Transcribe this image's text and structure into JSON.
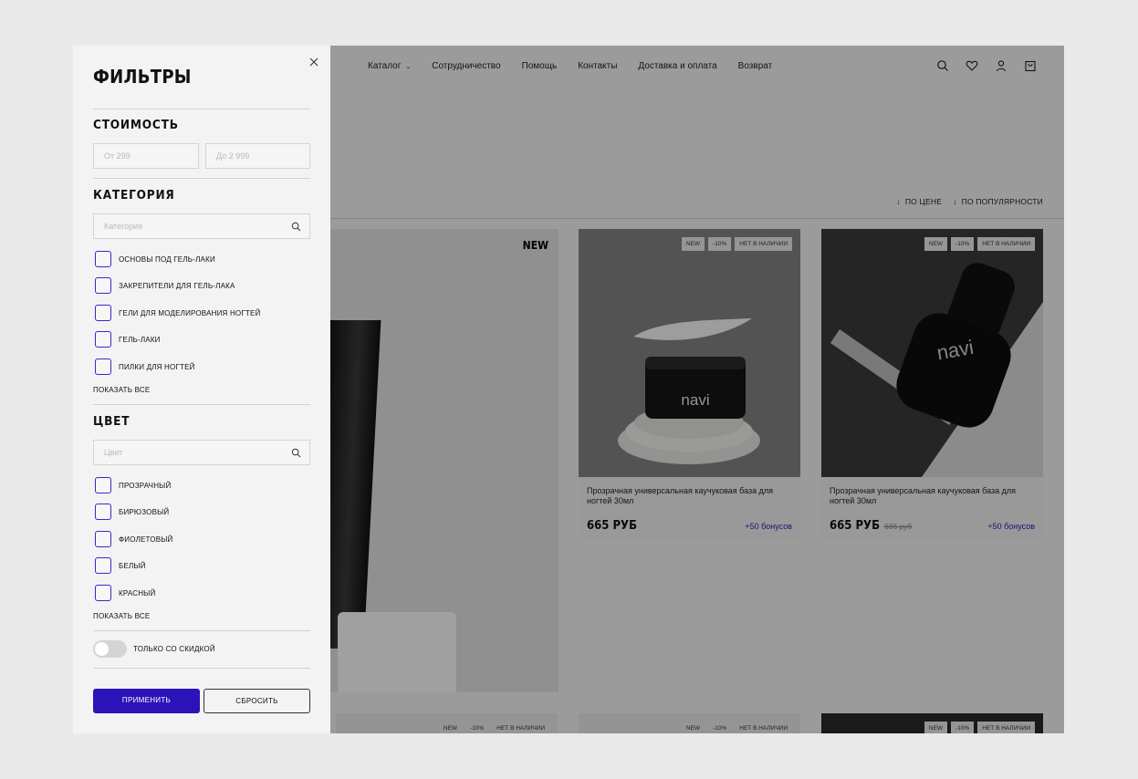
{
  "nav": {
    "items": [
      "Каталог",
      "Сотрудничество",
      "Помощь",
      "Контакты",
      "Доставка и оплата",
      "Возврат"
    ]
  },
  "header_icons": [
    "search-icon",
    "heart-icon",
    "user-icon",
    "bag-icon"
  ],
  "sort": {
    "by_price": "ПО ЦЕНЕ",
    "by_popularity": "ПО ПОПУЛЯРНОСТИ"
  },
  "hero": {
    "badge": "NEW"
  },
  "badges": {
    "new": "NEW",
    "discount": "-10%",
    "out": "НЕТ В НАЛИЧИИ"
  },
  "products": [
    {
      "title": "Прозрачная универсальная каучуковая база для ногтей 30мл",
      "price": "665 РУБ",
      "old_price": "",
      "bonus": "+50 бонусов",
      "brand": "navi"
    },
    {
      "title": "Прозрачная универсальная каучуковая база для ногтей 30мл",
      "price": "665 РУБ",
      "old_price": "686 руб",
      "bonus": "+50 бонусов",
      "brand": "navi"
    }
  ],
  "filters": {
    "title": "ФИЛЬТРЫ",
    "price": {
      "title": "СТОИМОСТЬ",
      "from_placeholder": "От 299",
      "to_placeholder": "До 2 999"
    },
    "category": {
      "title": "КАТЕГОРИЯ",
      "search_placeholder": "Категория",
      "options": [
        "основы под гель-лаки",
        "закрепители для гель-лака",
        "гели для моделирования ногтей",
        "гель-лаки",
        "пилки для ногтей"
      ],
      "show_all": "ПОКАЗАТЬ ВСЕ"
    },
    "color": {
      "title": "ЦВЕТ",
      "search_placeholder": "Цвет",
      "options": [
        "прозрачный",
        "бирюзовый",
        "фиолетовый",
        "белый",
        "красный"
      ],
      "show_all": "ПОКАЗАТЬ ВСЕ"
    },
    "discount_only": {
      "label": "ТОЛЬКО СО СКИДКОЙ",
      "enabled": false
    },
    "apply": "ПРИМЕНИТЬ",
    "reset": "СБРОСИТЬ"
  },
  "colors": {
    "accent": "#2c13b9",
    "bonus": "#2d1ab8"
  }
}
